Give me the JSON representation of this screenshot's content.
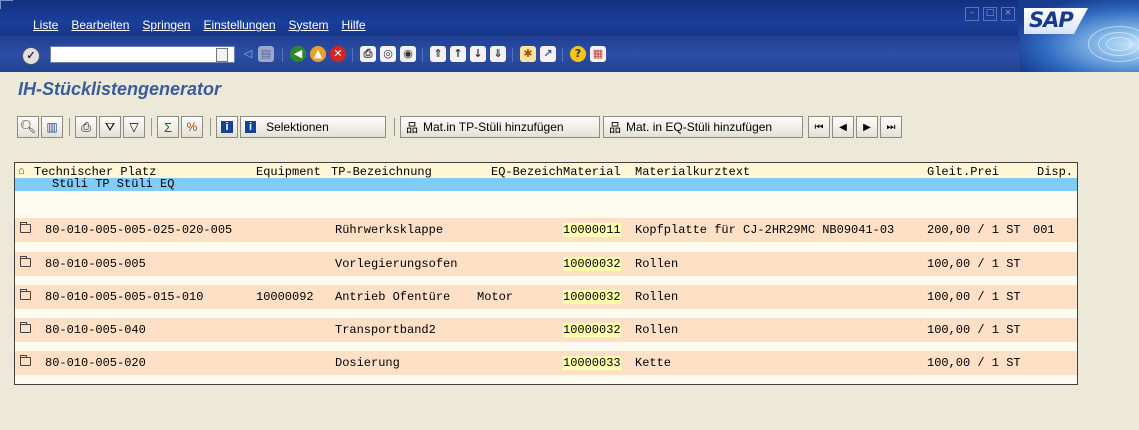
{
  "menu": [
    "Liste",
    "Bearbeiten",
    "Springen",
    "Einstellungen",
    "System",
    "Hilfe"
  ],
  "command_field": {
    "value": ""
  },
  "logo": {
    "text": "SAP"
  },
  "page_title": "IH-Stücklistengenerator",
  "app_toolbar": {
    "selektionen": "Selektionen",
    "add_tp": "Mat.in TP-Stüli hinzufügen",
    "add_eq": "Mat. in EQ-Stüli hinzufügen"
  },
  "table": {
    "headers": [
      "Technischer Platz",
      "Equipment",
      "TP-Bezeichnung",
      "EQ-Bezeich",
      "Material",
      "Materialkurztext",
      "Gleit.Prei",
      "Disp."
    ],
    "subheader": "Stüli TP Stüli EQ",
    "rows": [
      {
        "tp": "80-010-005-005-025-020-005",
        "equipment": "",
        "tp_bez": "Rührwerksklappe",
        "eq_bez": "",
        "material": "10000011",
        "kurztext": "Kopfplatte für CJ-2HR29MC NB09041-03",
        "preis": "200,00 / 1 ST",
        "disp": "001"
      },
      {
        "tp": "80-010-005-005",
        "equipment": "",
        "tp_bez": "Vorlegierungsofen",
        "eq_bez": "",
        "material": "10000032",
        "kurztext": "Rollen",
        "preis": "100,00 / 1 ST",
        "disp": ""
      },
      {
        "tp": "80-010-005-005-015-010",
        "equipment": "10000092",
        "tp_bez": "Antrieb Ofentüre",
        "eq_bez": "Motor",
        "material": "10000032",
        "kurztext": "Rollen",
        "preis": "100,00 / 1 ST",
        "disp": ""
      },
      {
        "tp": "80-010-005-040",
        "equipment": "",
        "tp_bez": "Transportband2",
        "eq_bez": "",
        "material": "10000032",
        "kurztext": "Rollen",
        "preis": "100,00 / 1 ST",
        "disp": ""
      },
      {
        "tp": "80-010-005-020",
        "equipment": "",
        "tp_bez": "Dosierung",
        "eq_bez": "",
        "material": "10000033",
        "kurztext": "Kette",
        "preis": "100,00 / 1 ST",
        "disp": ""
      }
    ]
  }
}
